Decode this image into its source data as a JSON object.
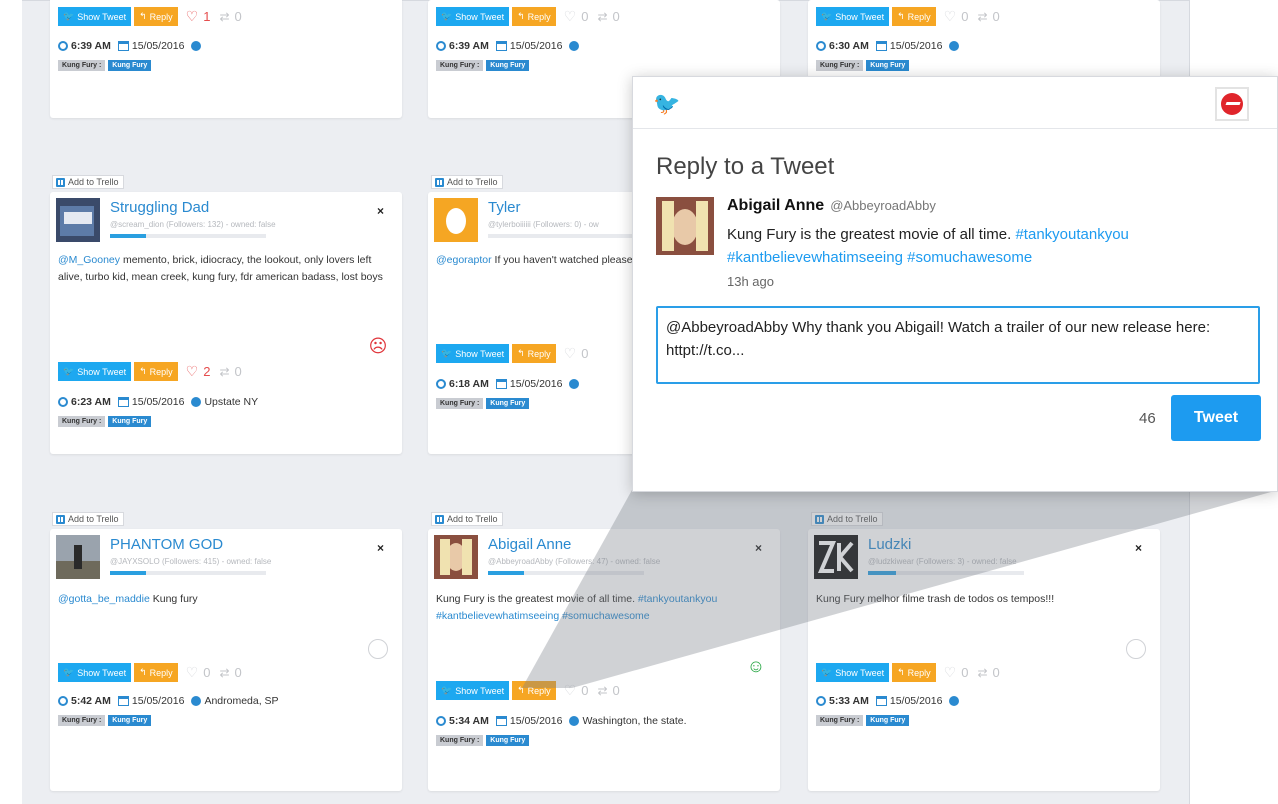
{
  "common": {
    "add_to_trello": "Add to Trello",
    "show_tweet": "Show Tweet",
    "reply": "Reply",
    "close": "×",
    "tag_label": "Kung Fury :",
    "tag_value": "Kung Fury"
  },
  "cards": [
    {
      "likes": "1",
      "retweets": "0",
      "time": "6:39 AM",
      "date": "15/05/2016",
      "location": ""
    },
    {
      "likes": "0",
      "retweets": "0",
      "time": "6:39 AM",
      "date": "15/05/2016",
      "location": ""
    },
    {
      "likes": "0",
      "retweets": "0",
      "time": "6:30 AM",
      "date": "15/05/2016",
      "location": ""
    },
    {
      "user": "Struggling Dad",
      "meta": "@scream_dion (Followers: 132) - owned: false",
      "mention": "@M_Gooney",
      "text": " memento, brick, idiocracy, the lookout, only lovers left alive, turbo kid, mean creek, kung fury, fdr american badass, lost boys",
      "likes": "2",
      "retweets": "0",
      "time": "6:23 AM",
      "date": "15/05/2016",
      "location": "Upstate NY",
      "sentiment": "☹"
    },
    {
      "user": "Tyler",
      "meta": "@tylerboiiiiii (Followers: 0) - ow",
      "mention": "@egoraptor",
      "text": " If you haven't watched please do. It will make you pee your",
      "likes": "0",
      "retweets": "",
      "time": "6:18 AM",
      "date": "15/05/2016",
      "location": ""
    },
    {
      "user": "PHANTOM GOD",
      "meta": "@JAYXSOLO (Followers: 415) - owned: false",
      "mention": "@gotta_be_maddie",
      "text": " Kung fury",
      "likes": "0",
      "retweets": "0",
      "time": "5:42 AM",
      "date": "15/05/2016",
      "location": "Andromeda, SP"
    },
    {
      "user": "Abigail Anne",
      "meta": "@AbbeyroadAbby (Followers: 47) - owned: false",
      "text": "Kung Fury is the greatest movie of all time. ",
      "tags": "#tankyoutankyou #kantbelievewhatimseeing #somuchawesome",
      "likes": "0",
      "retweets": "0",
      "time": "5:34 AM",
      "date": "15/05/2016",
      "location": "Washington, the state.",
      "sentiment": "☺"
    },
    {
      "user": "Ludzki",
      "meta": "@ludzkiwear (Followers: 3) - owned: false",
      "text": "Kung Fury melhor filme trash de todos os tempos!!!",
      "likes": "0",
      "retweets": "0",
      "time": "5:33 AM",
      "date": "15/05/2016",
      "location": ""
    }
  ],
  "popup": {
    "title": "Reply to a Tweet",
    "name": "Abigail Anne",
    "handle": "@AbbeyroadAbby",
    "text": "Kung Fury is the greatest movie of all time. ",
    "tags": "#tankyoutankyou #kantbelievewhatimseeing #somuchawesome",
    "time": "13h ago",
    "reply_text": "@AbbeyroadAbby Why thank you Abigail! Watch a trailer of our new release here: httpt://t.co...",
    "char_count": "46",
    "tweet_button": "Tweet"
  },
  "colors": {
    "twitter_blue": "#1d9bf0",
    "reply_orange": "#f6a623",
    "tag_blue": "#2a8ad0",
    "sad_red": "#e0343a",
    "happy_green": "#2aa846"
  }
}
